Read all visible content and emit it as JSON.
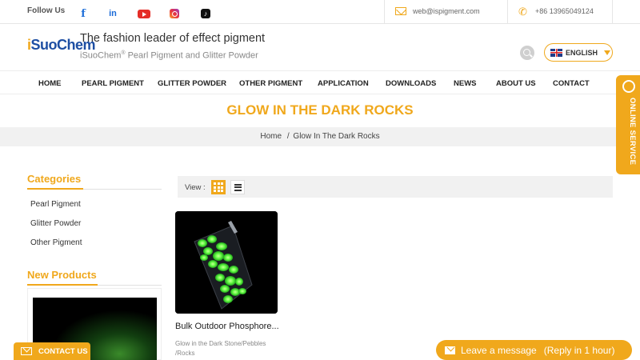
{
  "topbar": {
    "follow_label": "Follow Us",
    "social": [
      "facebook-icon",
      "linkedin-icon",
      "youtube-icon",
      "instagram-icon",
      "tiktok-icon"
    ],
    "facebook_glyph": "f",
    "linkedin_glyph": "in",
    "tiktok_glyph": "♪",
    "email": "web@ispigment.com",
    "phone": "+86 13965049124"
  },
  "header": {
    "logo_i": "i",
    "logo_rest": "SuoChem",
    "tagline": "The fashion leader of effect pigment",
    "subtagline_brand": "iSuoChem",
    "subtagline_reg": "®",
    "subtagline_rest": " Pearl Pigment and Glitter Powder",
    "language": "ENGLISH"
  },
  "nav": {
    "items": [
      "HOME",
      "PEARL PIGMENT",
      "GLITTER POWDER",
      "OTHER PIGMENT",
      "APPLICATION",
      "DOWNLOADS",
      "NEWS",
      "ABOUT US",
      "CONTACT"
    ]
  },
  "page": {
    "title": "GLOW IN THE DARK ROCKS",
    "breadcrumb_home": "Home",
    "breadcrumb_sep": "/",
    "breadcrumb_current": "Glow In The Dark Rocks"
  },
  "sidebar": {
    "categories_title": "Categories",
    "categories": [
      "Pearl Pigment",
      "Glitter Powder",
      "Other Pigment"
    ],
    "new_products_title": "New Products"
  },
  "content": {
    "view_label": "View :",
    "products": [
      {
        "name": "Bulk Outdoor Phosphore...",
        "category": "Glow in the Dark Stone/Pebbles /Rocks"
      }
    ]
  },
  "floating": {
    "online_service": "ONLINE SERVICE",
    "contact_us": "CONTACT US",
    "leave_message": "Leave a message",
    "reply_note": "(Reply in 1 hour)"
  },
  "colors": {
    "accent": "#f0a81c",
    "logo_blue": "#1e4fa3",
    "glow_green": "#6cff4a"
  }
}
